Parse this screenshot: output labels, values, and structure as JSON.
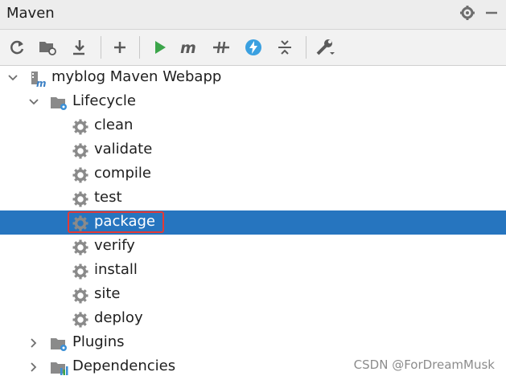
{
  "panel": {
    "title": "Maven"
  },
  "toolbar": {
    "icons": [
      "reload-icon",
      "add-folder-icon",
      "download-icon",
      "plus-icon",
      "run-icon",
      "maven-m-icon",
      "skip-tests-icon",
      "lightning-icon",
      "collapse-icon",
      "wrench-icon"
    ]
  },
  "tree": {
    "project": "myblog Maven Webapp",
    "lifecycle": "Lifecycle",
    "goals": [
      "clean",
      "validate",
      "compile",
      "test",
      "package",
      "verify",
      "install",
      "site",
      "deploy"
    ],
    "plugins": "Plugins",
    "dependencies": "Dependencies",
    "selected_goal": "package"
  },
  "watermark": "CSDN @ForDreamMusk",
  "colors": {
    "selection": "#2675bf",
    "highlight_box": "#e53935",
    "run_green": "#3ba54a",
    "lightning_blue": "#3aa0e0"
  }
}
